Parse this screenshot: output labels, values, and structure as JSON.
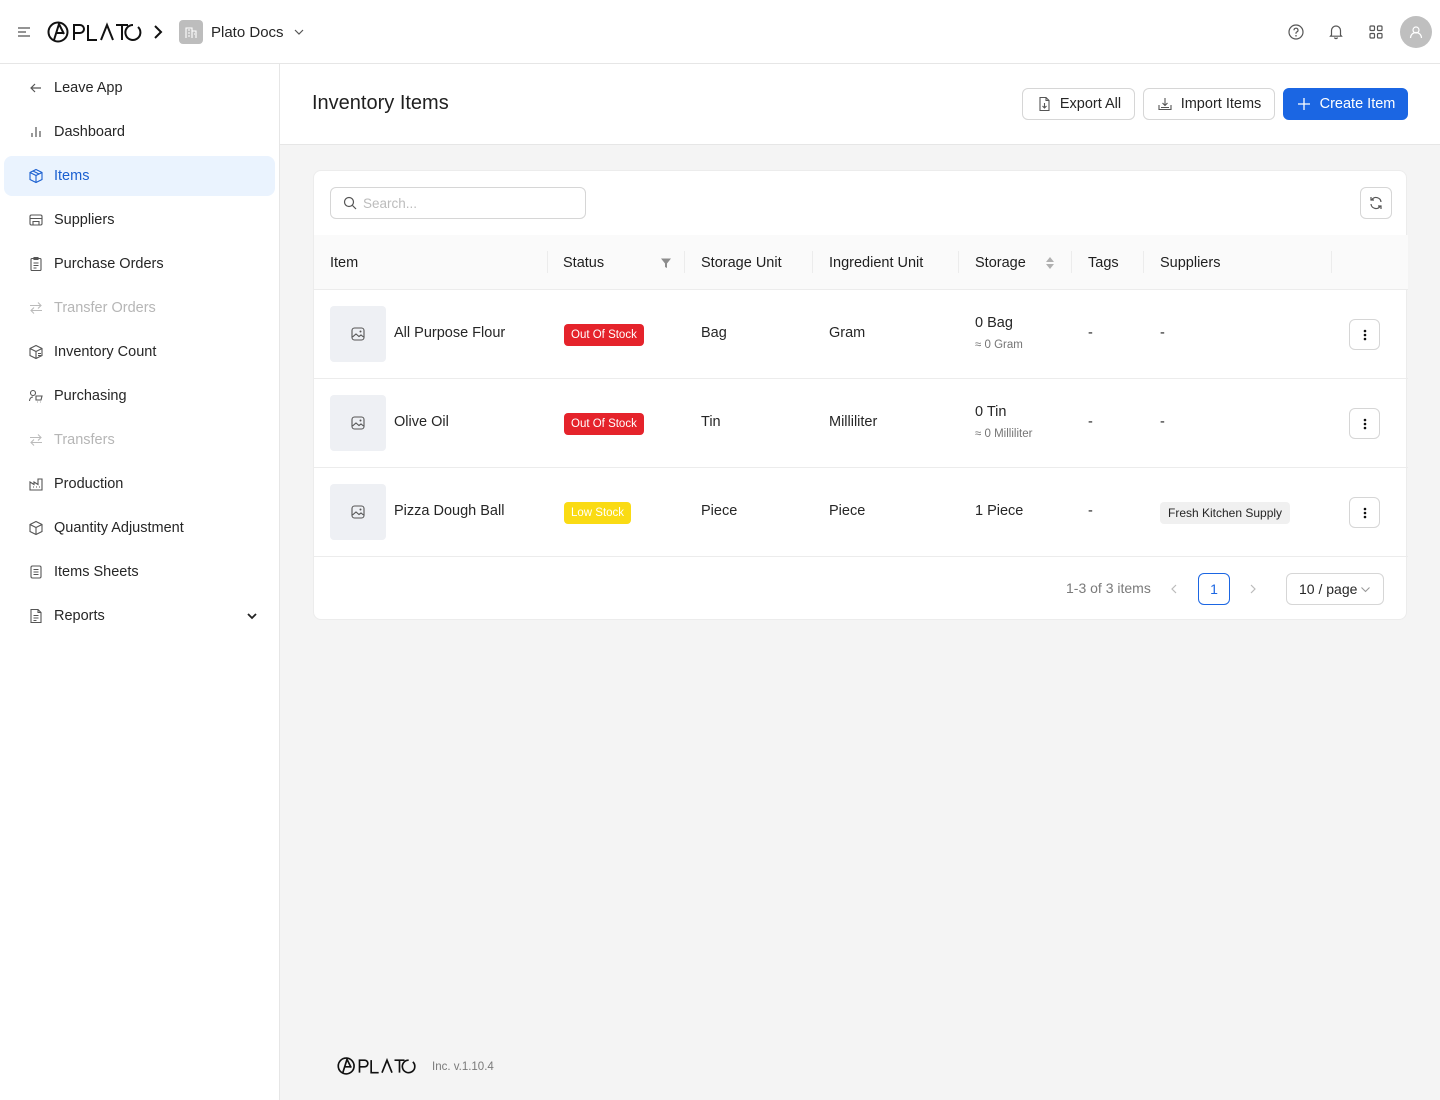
{
  "app": {
    "logo_text": "PLATO",
    "workspace": "Plato Docs"
  },
  "topbar": {
    "icons": [
      "help-icon",
      "bell-icon",
      "apps-grid-icon",
      "user-avatar-icon"
    ]
  },
  "sidebar": {
    "items": [
      {
        "label": "Leave App",
        "icon": "arrow-left-icon",
        "state": "normal"
      },
      {
        "label": "Dashboard",
        "icon": "bar-chart-icon",
        "state": "normal"
      },
      {
        "label": "Items",
        "icon": "box-icon",
        "state": "active"
      },
      {
        "label": "Suppliers",
        "icon": "store-icon",
        "state": "normal"
      },
      {
        "label": "Purchase Orders",
        "icon": "clipboard-icon",
        "state": "normal"
      },
      {
        "label": "Transfer Orders",
        "icon": "transfer-icon",
        "state": "disabled"
      },
      {
        "label": "Inventory Count",
        "icon": "boxes-icon",
        "state": "normal"
      },
      {
        "label": "Purchasing",
        "icon": "purchasing-icon",
        "state": "normal"
      },
      {
        "label": "Transfers",
        "icon": "transfer-icon",
        "state": "disabled"
      },
      {
        "label": "Production",
        "icon": "factory-icon",
        "state": "normal"
      },
      {
        "label": "Quantity Adjustment",
        "icon": "box-adjust-icon",
        "state": "normal"
      },
      {
        "label": "Items Sheets",
        "icon": "sheet-icon",
        "state": "normal"
      },
      {
        "label": "Reports",
        "icon": "report-icon",
        "state": "normal"
      }
    ]
  },
  "header": {
    "title": "Inventory Items",
    "export_label": "Export All",
    "import_label": "Import Items",
    "create_label": "Create Item"
  },
  "table": {
    "search_placeholder": "Search...",
    "columns": {
      "item": "Item",
      "status": "Status",
      "storage_unit": "Storage Unit",
      "ingredient_unit": "Ingredient Unit",
      "storage": "Storage",
      "tags": "Tags",
      "suppliers": "Suppliers"
    },
    "rows": [
      {
        "name": "All Purpose Flour",
        "status": "Out Of Stock",
        "status_color": "#e5232b",
        "storage_unit": "Bag",
        "ingredient_unit": "Gram",
        "storage": "0 Bag",
        "storage_sub": "≈ 0 Gram",
        "tags": "-",
        "suppliers": "-"
      },
      {
        "name": "Olive Oil",
        "status": "Out Of Stock",
        "status_color": "#e5232b",
        "storage_unit": "Tin",
        "ingredient_unit": "Milliliter",
        "storage": "0 Tin",
        "storage_sub": "≈ 0 Milliliter",
        "tags": "-",
        "suppliers": "-"
      },
      {
        "name": "Pizza Dough Ball",
        "status": "Low Stock",
        "status_color": "#fadb14",
        "storage_unit": "Piece",
        "ingredient_unit": "Piece",
        "storage": "1 Piece",
        "storage_sub": "",
        "tags": "-",
        "suppliers": "Fresh Kitchen Supply"
      }
    ]
  },
  "pagination": {
    "summary": "1-3 of 3 items",
    "current_page": "1",
    "page_size": "10 / page"
  },
  "footer": {
    "logo_text": "PLATO",
    "version": "Inc. v.1.10.4"
  },
  "colors": {
    "primary": "#1b66e3",
    "active_bg": "#eaf3fe",
    "danger": "#e5232b",
    "warning": "#fadb14"
  }
}
